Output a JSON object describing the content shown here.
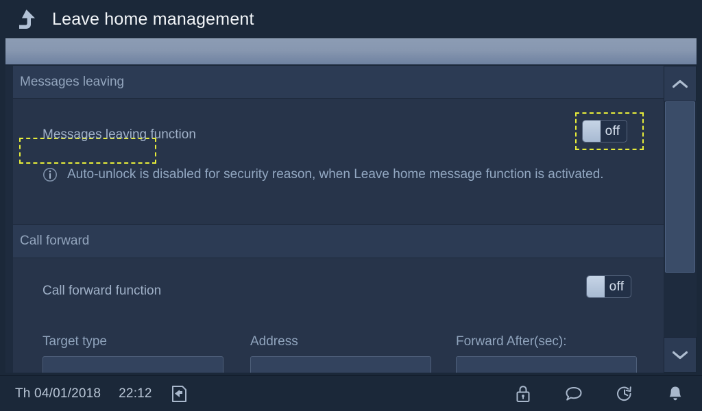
{
  "header": {
    "title": "Leave home management",
    "back_icon": "up-arrow-return-icon"
  },
  "sections": [
    {
      "id": "messages-leaving",
      "title": "Messages leaving",
      "focused": true,
      "rows": [
        {
          "id": "messages-leaving-function",
          "label": "Messages leaving function",
          "toggle_value": "off",
          "toggle_focused": true
        }
      ],
      "note": {
        "icon": "info-circle-icon",
        "text": "Auto-unlock is disabled for security reason, when Leave home message function is activated."
      }
    },
    {
      "id": "call-forward",
      "title": "Call forward",
      "focused": false,
      "rows": [
        {
          "id": "call-forward-function",
          "label": "Call forward function",
          "toggle_value": "off",
          "toggle_focused": false
        }
      ],
      "fields": [
        {
          "id": "target-type",
          "label": "Target type",
          "value": ""
        },
        {
          "id": "address",
          "label": "Address",
          "value": ""
        },
        {
          "id": "forward-after",
          "label": "Forward After(sec):",
          "value": ""
        }
      ]
    }
  ],
  "scrollbar": {
    "up_icon": "chevron-up-icon",
    "down_icon": "chevron-down-icon"
  },
  "statusbar": {
    "date": "Th 04/01/2018",
    "time": "22:12",
    "leave_home_icon": "leave-home-door-icon",
    "icons": [
      "lock-icon",
      "message-bubble-icon",
      "history-clock-icon",
      "bell-icon"
    ]
  },
  "colors": {
    "focus_ring": "#e8ee3a",
    "panel_bg": "#27344a",
    "section_bg": "#2c3b54",
    "chrome_bg": "#1b2839",
    "text_primary": "#f2f5f8",
    "text_secondary": "#9fb0c7"
  }
}
